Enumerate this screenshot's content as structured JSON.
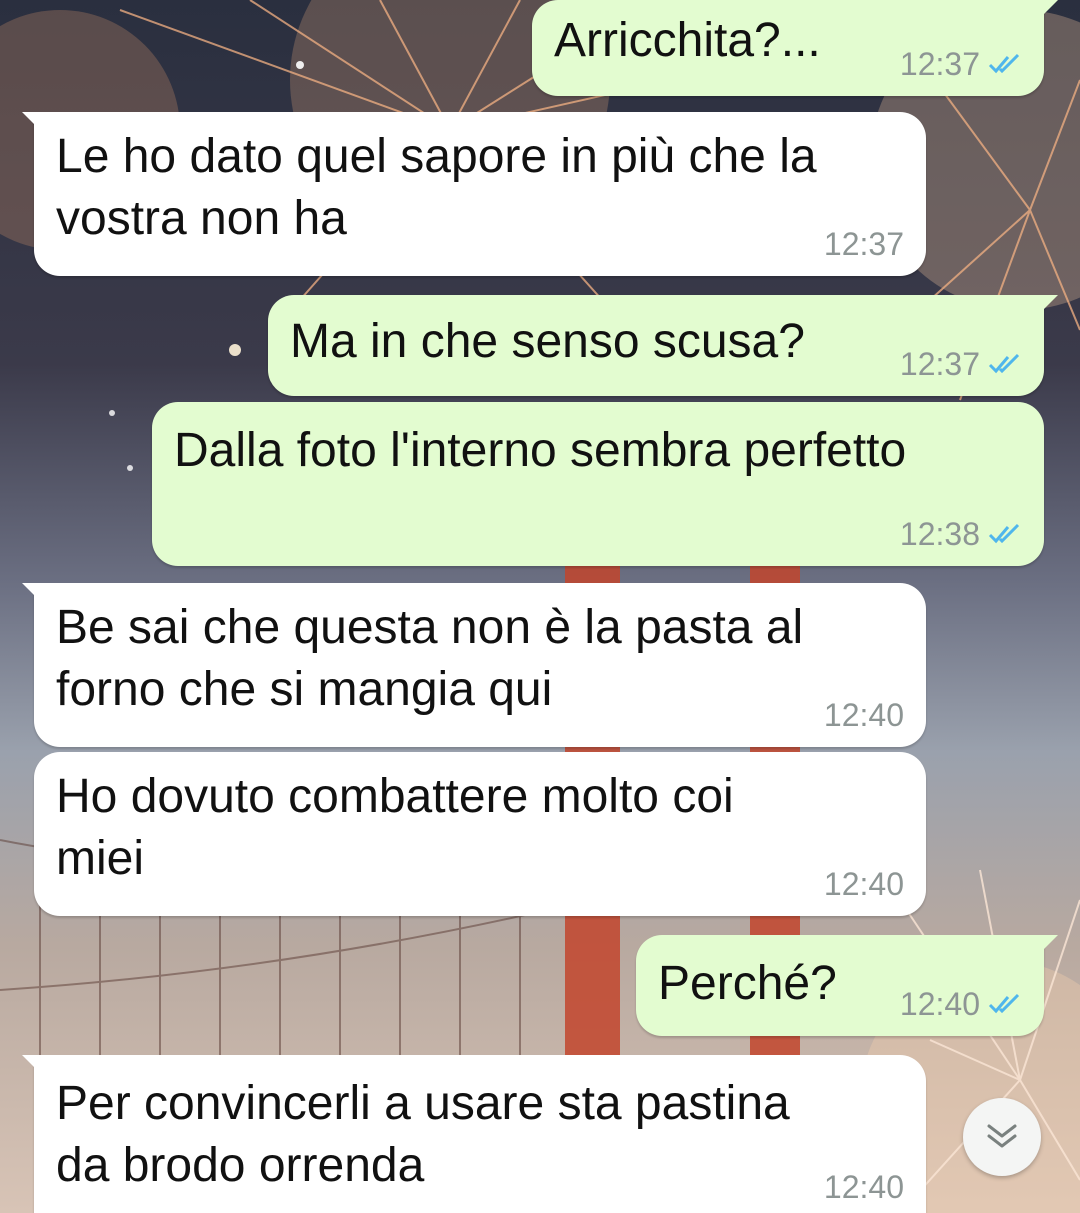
{
  "chat": {
    "messages": [
      {
        "direction": "out",
        "text_lines": [
          "Arricchita?..."
        ],
        "time": "12:37",
        "read": true
      },
      {
        "direction": "in",
        "text_lines": [
          "Le ho dato quel sapore in più che la",
          "vostra non ha"
        ],
        "time": "12:37"
      },
      {
        "direction": "out",
        "text_lines": [
          "Ma in che senso scusa?"
        ],
        "time": "12:37",
        "read": true
      },
      {
        "direction": "out",
        "text_lines": [
          "Dalla foto l'interno sembra perfetto"
        ],
        "time": "12:38",
        "read": true
      },
      {
        "direction": "in",
        "text_lines": [
          "Be sai che questa non è la pasta al",
          "forno che si mangia qui"
        ],
        "time": "12:40"
      },
      {
        "direction": "in",
        "text_lines": [
          "Ho dovuto combattere molto coi",
          "miei"
        ],
        "time": "12:40"
      },
      {
        "direction": "out",
        "text_lines": [
          "Perché?"
        ],
        "time": "12:40",
        "read": true
      },
      {
        "direction": "in",
        "text_lines": [
          "Per convincerli a usare sta pastina",
          "da brodo orrenda"
        ],
        "time": "12:40"
      }
    ]
  },
  "icons": {
    "read_receipt": "double-check-icon",
    "scroll_down": "chevron-double-down-icon"
  },
  "colors": {
    "incoming_bubble": "#ffffff",
    "outgoing_bubble": "#e3fcd0",
    "timestamp": "#8d9594",
    "read_ticks": "#4fb6ec"
  }
}
